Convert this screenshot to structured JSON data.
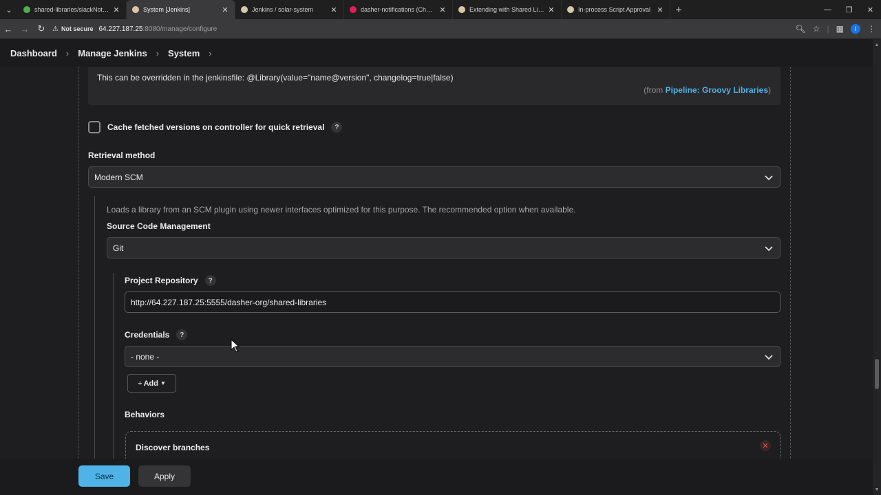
{
  "browser": {
    "tabs": [
      {
        "label": "shared-libraries/slackNotificatic",
        "fav_color": "#4caf50",
        "active": false
      },
      {
        "label": "System [Jenkins]",
        "fav_color": "#d9c7a8",
        "active": true
      },
      {
        "label": "Jenkins / solar-system",
        "fav_color": "#d9c7a8",
        "active": false
      },
      {
        "label": "dasher-notifications (Channel)",
        "fav_color": "#e01e5a",
        "active": false
      },
      {
        "label": "Extending with Shared Libraries",
        "fav_color": "#d9c7a8",
        "active": false
      },
      {
        "label": "In-process Script Approval",
        "fav_color": "#d9c7a8",
        "active": false
      }
    ],
    "address": {
      "warning_label": "Not secure",
      "host": "64.227.187.25",
      "path": ":8080/manage/configure"
    },
    "profile_initial": "I"
  },
  "breadcrumb": {
    "items": [
      "Dashboard",
      "Manage Jenkins",
      "System"
    ]
  },
  "infobox": {
    "text": "This can be overridden in the jenkinsfile: @Library(value=\"name@version\", changelog=true|false)",
    "from_prefix": "(from ",
    "from_link": "Pipeline: Groovy Libraries",
    "from_suffix": ")"
  },
  "cache": {
    "label": "Cache fetched versions on controller for quick retrieval",
    "checked": false
  },
  "retrieval": {
    "label": "Retrieval method",
    "value": "Modern SCM",
    "description": "Loads a library from an SCM plugin using newer interfaces optimized for this purpose. The recommended option when available."
  },
  "scm": {
    "label": "Source Code Management",
    "value": "Git"
  },
  "repo": {
    "label": "Project Repository",
    "value": "http://64.227.187.25:5555/dasher-org/shared-libraries"
  },
  "credentials": {
    "label": "Credentials",
    "value": "- none -",
    "add_label": "Add"
  },
  "behaviors": {
    "label": "Behaviors",
    "item_title": "Discover branches"
  },
  "actions": {
    "save_label": "Save",
    "apply_label": "Apply"
  },
  "colors": {
    "accent": "#4fb3e8",
    "danger": "#e05555"
  }
}
